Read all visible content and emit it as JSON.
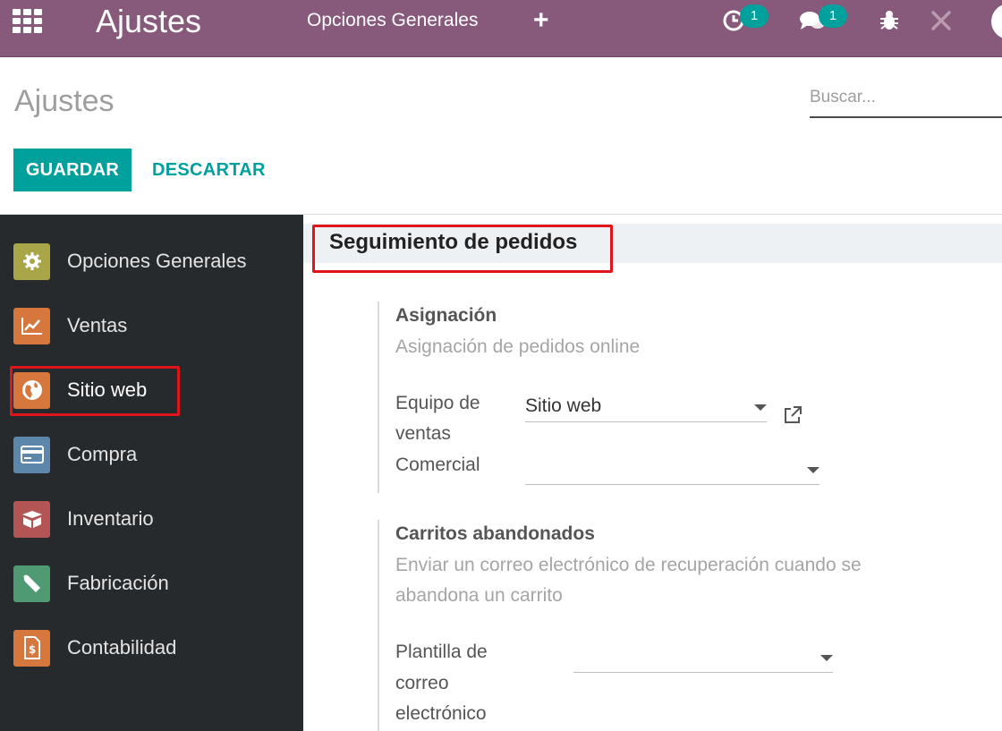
{
  "navbar": {
    "brand": "Ajustes",
    "menu_item": "Opciones Generales",
    "add_symbol": "+",
    "activity_count": "1",
    "messages_count": "1"
  },
  "control_panel": {
    "title": "Ajustes",
    "search_placeholder": "Buscar...",
    "save_label": "GUARDAR",
    "discard_label": "DESCARTAR"
  },
  "sidebar": {
    "items": [
      {
        "label": "Opciones Generales",
        "icon": "gear-icon",
        "color": "#a9a64a"
      },
      {
        "label": "Ventas",
        "icon": "chart-icon",
        "color": "#d6783d"
      },
      {
        "label": "Sitio web",
        "icon": "globe-icon",
        "color": "#d6783d"
      },
      {
        "label": "Compra",
        "icon": "card-icon",
        "color": "#5c87aa"
      },
      {
        "label": "Inventario",
        "icon": "box-icon",
        "color": "#b35555"
      },
      {
        "label": "Fabricación",
        "icon": "wrench-icon",
        "color": "#4f9a73"
      },
      {
        "label": "Contabilidad",
        "icon": "invoice-icon",
        "color": "#d6783d"
      }
    ],
    "active": "Sitio web"
  },
  "main": {
    "section_title": "Seguimiento de pedidos",
    "assignment": {
      "title": "Asignación",
      "description": "Asignación de pedidos online",
      "team_label_1": "Equipo de",
      "team_label_2": "ventas",
      "team_value": "Sitio web",
      "salesperson_label": "Comercial",
      "salesperson_value": ""
    },
    "abandoned": {
      "title": "Carritos abandonados",
      "description_1": "Enviar un correo electrónico de recuperación cuando se",
      "description_2": "abandona un carrito",
      "template_label_1": "Plantilla de",
      "template_label_2": "correo",
      "template_label_3": "electrónico",
      "template_value": ""
    }
  },
  "colors": {
    "navbar": "#875a7b",
    "primary": "#00a09d",
    "sidebar": "#262a2d",
    "highlight": "#e0151c"
  }
}
